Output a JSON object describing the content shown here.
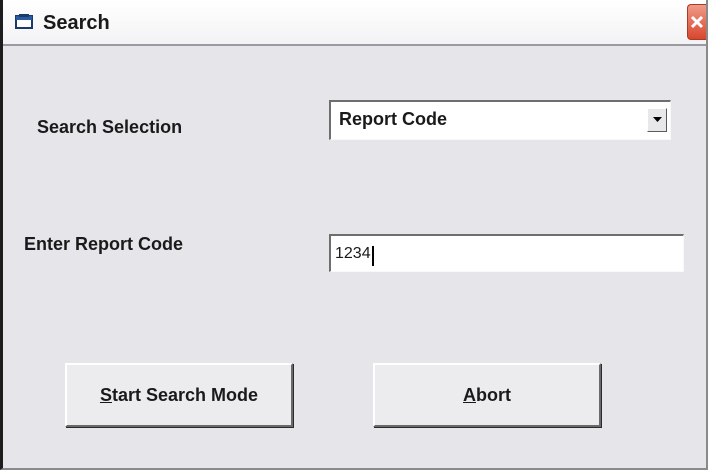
{
  "window": {
    "title": "Search"
  },
  "form": {
    "search_selection_label": "Search Selection",
    "search_selection_value": "Report Code",
    "report_code_label": "Enter Report Code",
    "report_code_value": "1234"
  },
  "buttons": {
    "start_search_mnemonic": "S",
    "start_search_rest": "tart Search Mode",
    "abort_mnemonic": "A",
    "abort_rest": "bort"
  },
  "colors": {
    "window_bg": "#e6e6ea",
    "close_button": "#d8462e"
  },
  "icons": {
    "title_icon": "window-icon",
    "close_icon": "close-icon",
    "dropdown_icon": "chevron-down-icon"
  }
}
